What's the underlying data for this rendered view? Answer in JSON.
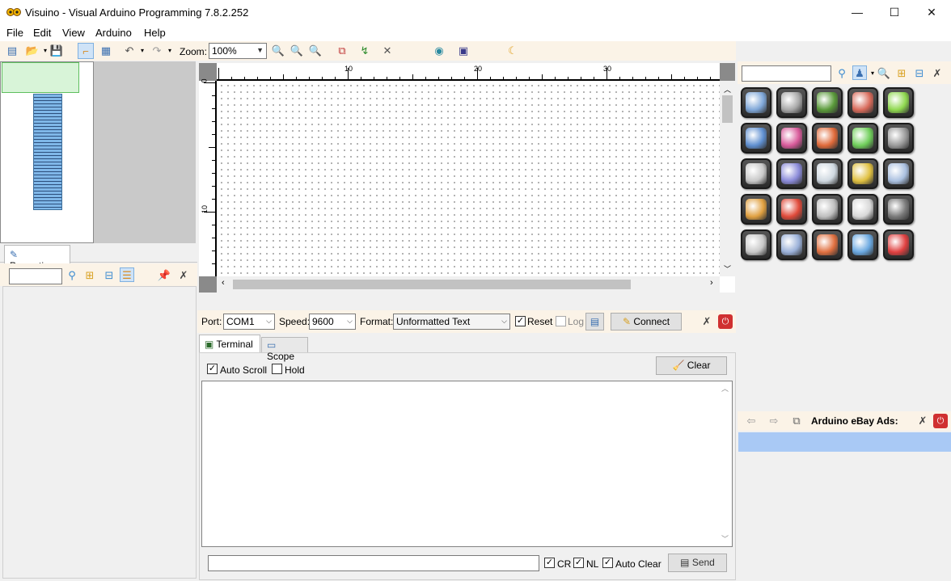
{
  "window": {
    "title": "Visuino - Visual Arduino Programming 7.8.2.252",
    "minimize": "—",
    "maximize": "☐",
    "close": "✕"
  },
  "menu": [
    "File",
    "Edit",
    "View",
    "Arduino",
    "Help"
  ],
  "toolbar": {
    "zoom_label": "Zoom:",
    "zoom_value": "100%"
  },
  "ruler": {
    "top_labels": [
      "10",
      "20",
      "30"
    ],
    "left_labels": [
      "0",
      "10"
    ]
  },
  "properties": {
    "tab_label": "Properties",
    "search_value": ""
  },
  "serial": {
    "port_label": "Port:",
    "port_value": "COM1",
    "speed_label": "Speed:",
    "speed_value": "9600",
    "format_label": "Format:",
    "format_value": "Unformatted Text",
    "reset_label": "Reset",
    "reset_checked": true,
    "log_label": "Log",
    "log_checked": false,
    "connect_label": "Connect"
  },
  "terminal": {
    "tabs": [
      "Terminal",
      "Scope"
    ],
    "auto_scroll_label": "Auto Scroll",
    "hold_label": "Hold",
    "clear_label": "Clear",
    "output": "",
    "send_value": "",
    "cr_label": "CR",
    "nl_label": "NL",
    "auto_clear_label": "Auto Clear",
    "send_label": "Send"
  },
  "palette": {
    "search_value": "",
    "items": [
      {
        "name": "calculator-icon",
        "color": "#7fa7d8"
      },
      {
        "name": "tools-icon",
        "color": "#a8a8a8"
      },
      {
        "name": "board-icon",
        "color": "#5a9a3a"
      },
      {
        "name": "printer-icon",
        "color": "#d86a5a"
      },
      {
        "name": "grid-icon",
        "color": "#8fd84f"
      },
      {
        "name": "numbers-icon",
        "color": "#5f8fd0"
      },
      {
        "name": "color-dots-icon",
        "color": "#d85a9a"
      },
      {
        "name": "text-abc-icon",
        "color": "#e06a3a"
      },
      {
        "name": "math-icon",
        "color": "#6fce5a"
      },
      {
        "name": "motor-icon",
        "color": "#9a9a9a"
      },
      {
        "name": "box-icon",
        "color": "#c8c8c8"
      },
      {
        "name": "gamepad-icon",
        "color": "#8a8ad8"
      },
      {
        "name": "tap-icon",
        "color": "#cfd8e0"
      },
      {
        "name": "color-wheel-icon",
        "color": "#e0c040"
      },
      {
        "name": "network-icon",
        "color": "#aac0e0"
      },
      {
        "name": "arrows-icon",
        "color": "#e0a040"
      },
      {
        "name": "star-icon",
        "color": "#e04a3a"
      },
      {
        "name": "speaker-icon",
        "color": "#bfbfbf"
      },
      {
        "name": "binary-icon",
        "color": "#d8d8d8"
      },
      {
        "name": "chip-icon",
        "color": "#7a7a7a"
      },
      {
        "name": "filter-icon",
        "color": "#c8c8c8"
      },
      {
        "name": "door-icon",
        "color": "#9ab0d8"
      },
      {
        "name": "eraser-icon",
        "color": "#e07040"
      },
      {
        "name": "clock-icon",
        "color": "#6aa8e0"
      },
      {
        "name": "power-icon",
        "color": "#e04040"
      }
    ]
  },
  "ads": {
    "title": "Arduino eBay Ads:"
  }
}
